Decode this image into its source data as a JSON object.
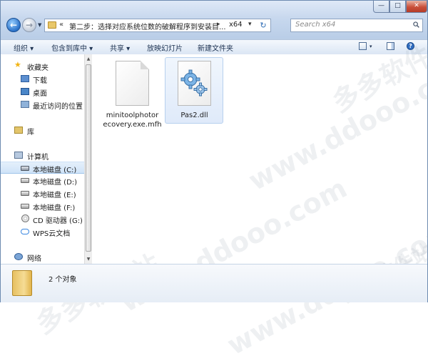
{
  "window": {
    "controls": {
      "minimize": "—",
      "maximize": "□",
      "close": "✕"
    }
  },
  "address": {
    "chevron": "«",
    "path": "第二步：选择对应系统位数的破解程序到安装目...",
    "arrow": "▸",
    "current": "x64",
    "dropdown": "▾",
    "refresh": "↻"
  },
  "search": {
    "placeholder": "Search x64"
  },
  "toolbar": {
    "organize": "组织 ▾",
    "include_library": "包含到库中 ▾",
    "share": "共享 ▾",
    "slideshow": "放映幻灯片",
    "new_folder": "新建文件夹",
    "help": "?"
  },
  "sidebar": {
    "favorites": {
      "label": "收藏夹",
      "items": [
        {
          "label": "下载"
        },
        {
          "label": "桌面"
        },
        {
          "label": "最近访问的位置"
        }
      ]
    },
    "libraries": {
      "label": "库"
    },
    "computer": {
      "label": "计算机",
      "items": [
        {
          "label": "本地磁盘 (C:)"
        },
        {
          "label": "本地磁盘 (D:)"
        },
        {
          "label": "本地磁盘 (E:)"
        },
        {
          "label": "本地磁盘 (F:)"
        },
        {
          "label": "CD 驱动器 (G:)"
        },
        {
          "label": "WPS云文档"
        }
      ]
    },
    "network": {
      "label": "网络"
    }
  },
  "files": [
    {
      "name_line1": "minitoolphotor",
      "name_line2": "ecovery.exe.mfh",
      "icon": "document-icon"
    },
    {
      "name_line1": "Pas2.dll",
      "name_line2": "",
      "icon": "gears-icon"
    }
  ],
  "status": {
    "text": "2 个对象"
  },
  "watermarks": [
    "多多软件站",
    "www.ddooo.com",
    "www.ddooo.com",
    "多多软件站",
    "www.ddooo.com",
    "多多软件站"
  ]
}
